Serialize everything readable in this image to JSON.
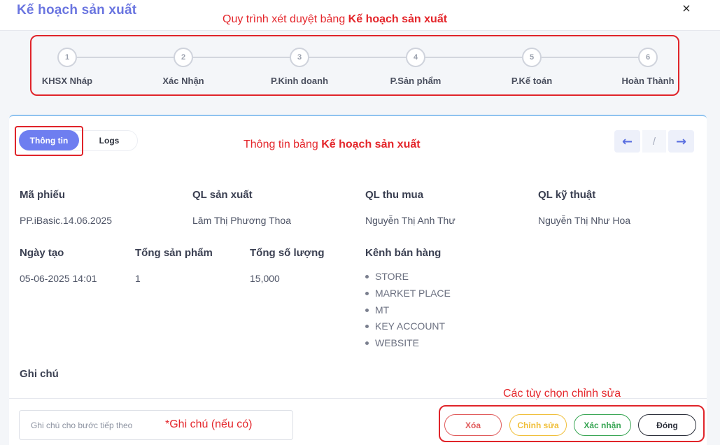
{
  "window": {
    "title": "Kế hoạch sản xuất",
    "close_symbol": "×"
  },
  "annotations": {
    "workflow_prefix": "Quy trình xét duyệt bảng ",
    "workflow_bold": "Kế hoạch sản xuất",
    "info_prefix": "Thông tin bảng ",
    "info_bold": "Kế hoạch sản xuất",
    "edit_options": "Các tùy chọn chỉnh sửa",
    "note_hint": "*Ghi chú (nếu có)"
  },
  "stepper": {
    "steps": [
      {
        "number": "1",
        "label": "KHSX Nháp"
      },
      {
        "number": "2",
        "label": "Xác Nhận"
      },
      {
        "number": "3",
        "label": "P.Kinh doanh"
      },
      {
        "number": "4",
        "label": "P.Sản phẩm"
      },
      {
        "number": "5",
        "label": "P.Kế toán"
      },
      {
        "number": "6",
        "label": "Hoàn Thành"
      }
    ]
  },
  "tabs": {
    "info": "Thông tin",
    "logs": "Logs",
    "active": "info"
  },
  "pager": {
    "prev_icon": "←",
    "separator": "/",
    "next_icon": "→"
  },
  "fields": {
    "ma_phieu": {
      "label": "Mã phiếu",
      "value": "PP.iBasic.14.06.2025"
    },
    "ql_san_xuat": {
      "label": "QL sản xuất",
      "value": "Lâm Thị Phương Thoa"
    },
    "ql_thu_mua": {
      "label": "QL thu mua",
      "value": "Nguyễn Thị Anh Thư"
    },
    "ql_ky_thuat": {
      "label": "QL kỹ thuật",
      "value": "Nguyễn Thị Như Hoa"
    },
    "ngay_tao": {
      "label": "Ngày tạo",
      "value": "05-06-2025 14:01"
    },
    "tong_san_pham": {
      "label": "Tổng sản phẩm",
      "value": "1"
    },
    "tong_so_luong": {
      "label": "Tổng số lượng",
      "value": "15,000"
    },
    "kenh_ban_hang": {
      "label": "Kênh bán hàng",
      "items": [
        "STORE",
        "MARKET PLACE",
        "MT",
        "KEY ACCOUNT",
        "WEBSITE"
      ]
    },
    "ghi_chu": {
      "label": "Ghi chú"
    }
  },
  "footer": {
    "note_placeholder": "Ghi chú cho bước tiếp theo",
    "buttons": {
      "delete": "Xóa",
      "edit": "Chỉnh sửa",
      "confirm": "Xác nhận",
      "close": "Đóng"
    }
  },
  "colors": {
    "accent": "#6e7ef0",
    "annotation_red": "#e4262b",
    "delete": "#e05a5a",
    "edit": "#f0bf3a",
    "confirm": "#3aa655",
    "close": "#2b2f3a"
  }
}
